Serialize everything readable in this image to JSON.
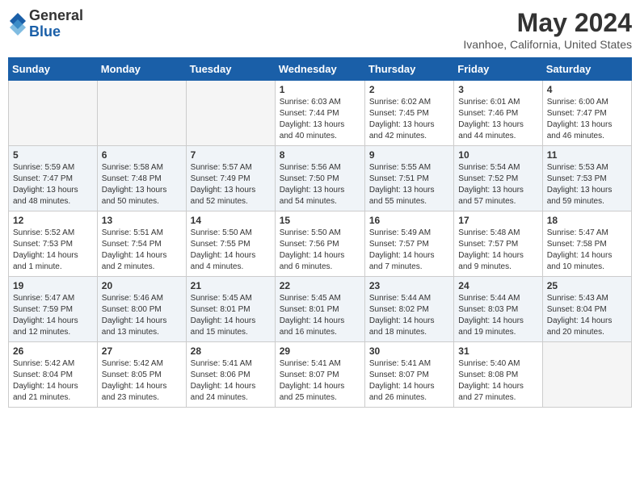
{
  "header": {
    "logo_general": "General",
    "logo_blue": "Blue",
    "month_title": "May 2024",
    "subtitle": "Ivanhoe, California, United States"
  },
  "weekdays": [
    "Sunday",
    "Monday",
    "Tuesday",
    "Wednesday",
    "Thursday",
    "Friday",
    "Saturday"
  ],
  "weeks": [
    [
      {
        "day": "",
        "info": ""
      },
      {
        "day": "",
        "info": ""
      },
      {
        "day": "",
        "info": ""
      },
      {
        "day": "1",
        "info": "Sunrise: 6:03 AM\nSunset: 7:44 PM\nDaylight: 13 hours\nand 40 minutes."
      },
      {
        "day": "2",
        "info": "Sunrise: 6:02 AM\nSunset: 7:45 PM\nDaylight: 13 hours\nand 42 minutes."
      },
      {
        "day": "3",
        "info": "Sunrise: 6:01 AM\nSunset: 7:46 PM\nDaylight: 13 hours\nand 44 minutes."
      },
      {
        "day": "4",
        "info": "Sunrise: 6:00 AM\nSunset: 7:47 PM\nDaylight: 13 hours\nand 46 minutes."
      }
    ],
    [
      {
        "day": "5",
        "info": "Sunrise: 5:59 AM\nSunset: 7:47 PM\nDaylight: 13 hours\nand 48 minutes."
      },
      {
        "day": "6",
        "info": "Sunrise: 5:58 AM\nSunset: 7:48 PM\nDaylight: 13 hours\nand 50 minutes."
      },
      {
        "day": "7",
        "info": "Sunrise: 5:57 AM\nSunset: 7:49 PM\nDaylight: 13 hours\nand 52 minutes."
      },
      {
        "day": "8",
        "info": "Sunrise: 5:56 AM\nSunset: 7:50 PM\nDaylight: 13 hours\nand 54 minutes."
      },
      {
        "day": "9",
        "info": "Sunrise: 5:55 AM\nSunset: 7:51 PM\nDaylight: 13 hours\nand 55 minutes."
      },
      {
        "day": "10",
        "info": "Sunrise: 5:54 AM\nSunset: 7:52 PM\nDaylight: 13 hours\nand 57 minutes."
      },
      {
        "day": "11",
        "info": "Sunrise: 5:53 AM\nSunset: 7:53 PM\nDaylight: 13 hours\nand 59 minutes."
      }
    ],
    [
      {
        "day": "12",
        "info": "Sunrise: 5:52 AM\nSunset: 7:53 PM\nDaylight: 14 hours\nand 1 minute."
      },
      {
        "day": "13",
        "info": "Sunrise: 5:51 AM\nSunset: 7:54 PM\nDaylight: 14 hours\nand 2 minutes."
      },
      {
        "day": "14",
        "info": "Sunrise: 5:50 AM\nSunset: 7:55 PM\nDaylight: 14 hours\nand 4 minutes."
      },
      {
        "day": "15",
        "info": "Sunrise: 5:50 AM\nSunset: 7:56 PM\nDaylight: 14 hours\nand 6 minutes."
      },
      {
        "day": "16",
        "info": "Sunrise: 5:49 AM\nSunset: 7:57 PM\nDaylight: 14 hours\nand 7 minutes."
      },
      {
        "day": "17",
        "info": "Sunrise: 5:48 AM\nSunset: 7:57 PM\nDaylight: 14 hours\nand 9 minutes."
      },
      {
        "day": "18",
        "info": "Sunrise: 5:47 AM\nSunset: 7:58 PM\nDaylight: 14 hours\nand 10 minutes."
      }
    ],
    [
      {
        "day": "19",
        "info": "Sunrise: 5:47 AM\nSunset: 7:59 PM\nDaylight: 14 hours\nand 12 minutes."
      },
      {
        "day": "20",
        "info": "Sunrise: 5:46 AM\nSunset: 8:00 PM\nDaylight: 14 hours\nand 13 minutes."
      },
      {
        "day": "21",
        "info": "Sunrise: 5:45 AM\nSunset: 8:01 PM\nDaylight: 14 hours\nand 15 minutes."
      },
      {
        "day": "22",
        "info": "Sunrise: 5:45 AM\nSunset: 8:01 PM\nDaylight: 14 hours\nand 16 minutes."
      },
      {
        "day": "23",
        "info": "Sunrise: 5:44 AM\nSunset: 8:02 PM\nDaylight: 14 hours\nand 18 minutes."
      },
      {
        "day": "24",
        "info": "Sunrise: 5:44 AM\nSunset: 8:03 PM\nDaylight: 14 hours\nand 19 minutes."
      },
      {
        "day": "25",
        "info": "Sunrise: 5:43 AM\nSunset: 8:04 PM\nDaylight: 14 hours\nand 20 minutes."
      }
    ],
    [
      {
        "day": "26",
        "info": "Sunrise: 5:42 AM\nSunset: 8:04 PM\nDaylight: 14 hours\nand 21 minutes."
      },
      {
        "day": "27",
        "info": "Sunrise: 5:42 AM\nSunset: 8:05 PM\nDaylight: 14 hours\nand 23 minutes."
      },
      {
        "day": "28",
        "info": "Sunrise: 5:41 AM\nSunset: 8:06 PM\nDaylight: 14 hours\nand 24 minutes."
      },
      {
        "day": "29",
        "info": "Sunrise: 5:41 AM\nSunset: 8:07 PM\nDaylight: 14 hours\nand 25 minutes."
      },
      {
        "day": "30",
        "info": "Sunrise: 5:41 AM\nSunset: 8:07 PM\nDaylight: 14 hours\nand 26 minutes."
      },
      {
        "day": "31",
        "info": "Sunrise: 5:40 AM\nSunset: 8:08 PM\nDaylight: 14 hours\nand 27 minutes."
      },
      {
        "day": "",
        "info": ""
      }
    ]
  ]
}
